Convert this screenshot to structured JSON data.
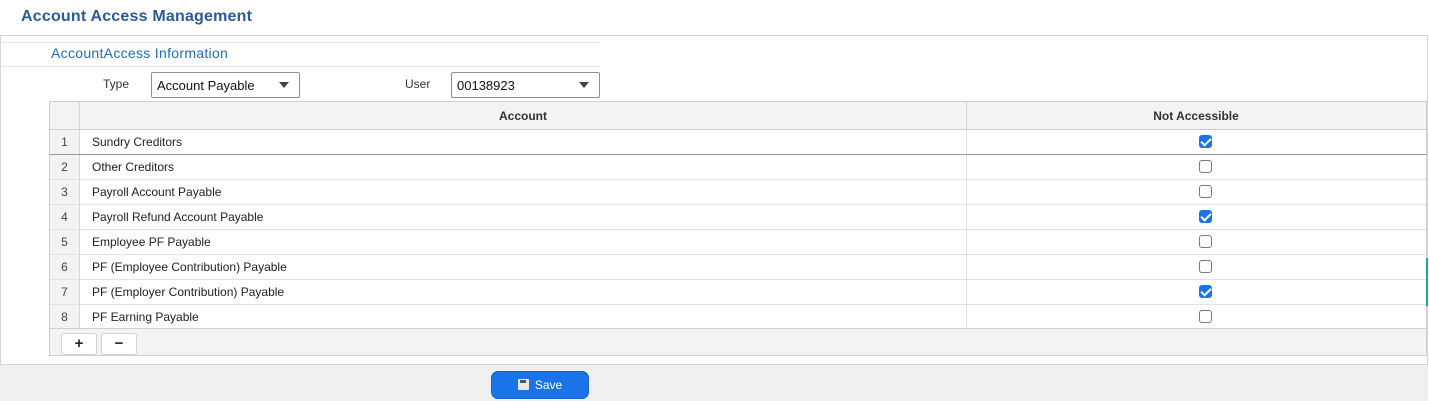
{
  "header": {
    "title": "Account Access Management"
  },
  "section": {
    "title": "AccountAccess Information"
  },
  "filters": {
    "type_label": "Type",
    "type_value": "Account Payable",
    "user_label": "User",
    "user_value": "00138923"
  },
  "table": {
    "columns": [
      "Account",
      "Not Accessible"
    ],
    "rows": [
      {
        "num": "1",
        "account": "Sundry Creditors",
        "not_accessible": true
      },
      {
        "num": "2",
        "account": "Other Creditors",
        "not_accessible": false
      },
      {
        "num": "3",
        "account": "Payroll Account Payable",
        "not_accessible": false
      },
      {
        "num": "4",
        "account": "Payroll Refund Account Payable",
        "not_accessible": true
      },
      {
        "num": "5",
        "account": "Employee PF Payable",
        "not_accessible": false
      },
      {
        "num": "6",
        "account": "PF (Employee Contribution) Payable",
        "not_accessible": false
      },
      {
        "num": "7",
        "account": "PF (Employer Contribution) Payable",
        "not_accessible": true
      },
      {
        "num": "8",
        "account": "PF Earning Payable",
        "not_accessible": false
      }
    ],
    "add_label": "+",
    "remove_label": "−"
  },
  "footer": {
    "save_label": "Save",
    "save_icon": "floppy-disk-icon"
  },
  "colors": {
    "accent": "#1a73e8",
    "title": "#2c5a96",
    "section": "#1f6bbf"
  }
}
